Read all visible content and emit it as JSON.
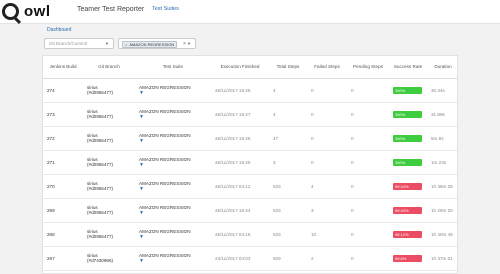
{
  "header": {
    "logo_text": "owl",
    "app_title": "Teamer Test Reporter",
    "nav_link": "Test Suites"
  },
  "breadcrumb": "Dashboard",
  "filters": {
    "branch_placeholder": "Git Branch/Commit",
    "suite_tag": "AMAZON REGRESSION",
    "suite_tag_remove": "×",
    "clear": "×"
  },
  "colors": {
    "pass": "#3fcc3f",
    "fail": "#ea4d64",
    "link": "#2a6db5"
  },
  "table": {
    "columns": [
      "Jenkins Build",
      "Git Branch",
      "Test Suite",
      "Execution Finished",
      "Total Steps",
      "Failed Steps",
      "Pending Steps",
      "Success Rate",
      "Duration"
    ],
    "rows": [
      {
        "build": "274",
        "branch": "sirius",
        "commit": "(#d0955477)",
        "suite": "AMAZON REGRESSION",
        "finished": "26/11/2017 15:29",
        "total": "4",
        "failed": "0",
        "pending": "0",
        "rate": "100%",
        "status": "pass",
        "duration": "30.34s"
      },
      {
        "build": "273",
        "branch": "sirius",
        "commit": "(#d0955477)",
        "suite": "AMAZON REGRESSION",
        "finished": "26/11/2017 15:27",
        "total": "4",
        "failed": "0",
        "pending": "0",
        "rate": "100%",
        "status": "pass",
        "duration": "31.89s"
      },
      {
        "build": "272",
        "branch": "sirius",
        "commit": "(#d0955477)",
        "suite": "AMAZON REGRESSION",
        "finished": "26/11/2017 15:25",
        "total": "47",
        "failed": "0",
        "pending": "0",
        "rate": "100%",
        "status": "pass",
        "duration": "5m 8s"
      },
      {
        "build": "271",
        "branch": "sirius",
        "commit": "(#d0955477)",
        "suite": "AMAZON REGRESSION",
        "finished": "26/11/2017 15:20",
        "total": "3",
        "failed": "0",
        "pending": "0",
        "rate": "100%",
        "status": "pass",
        "duration": "1m 23s"
      },
      {
        "build": "270",
        "branch": "sirius",
        "commit": "(#d0955477)",
        "suite": "AMAZON REGRESSION",
        "finished": "26/11/2017 04:12",
        "total": "533",
        "failed": "4",
        "pending": "0",
        "rate": "99.24%",
        "status": "fail",
        "duration": "1h 35m 09"
      },
      {
        "build": "269",
        "branch": "sirius",
        "commit": "(#d0955477)",
        "suite": "AMAZON REGRESSION",
        "finished": "25/11/2017 16:44",
        "total": "533",
        "failed": "3",
        "pending": "0",
        "rate": "99.43%",
        "status": "fail",
        "duration": "1h 29m 20"
      },
      {
        "build": "268",
        "branch": "sirius",
        "commit": "(#d0955477)",
        "suite": "AMAZON REGRESSION",
        "finished": "25/11/2017 04:16",
        "total": "533",
        "failed": "10",
        "pending": "0",
        "rate": "98.12%",
        "status": "fail",
        "duration": "1h 40m 49"
      },
      {
        "build": "267",
        "branch": "sirius",
        "commit": "(#d7430966)",
        "suite": "AMAZON REGRESSION",
        "finished": "24/11/2017 04:03",
        "total": "509",
        "failed": "2",
        "pending": "0",
        "rate": "99.6%",
        "status": "fail",
        "duration": "1h 37m 01"
      }
    ]
  }
}
